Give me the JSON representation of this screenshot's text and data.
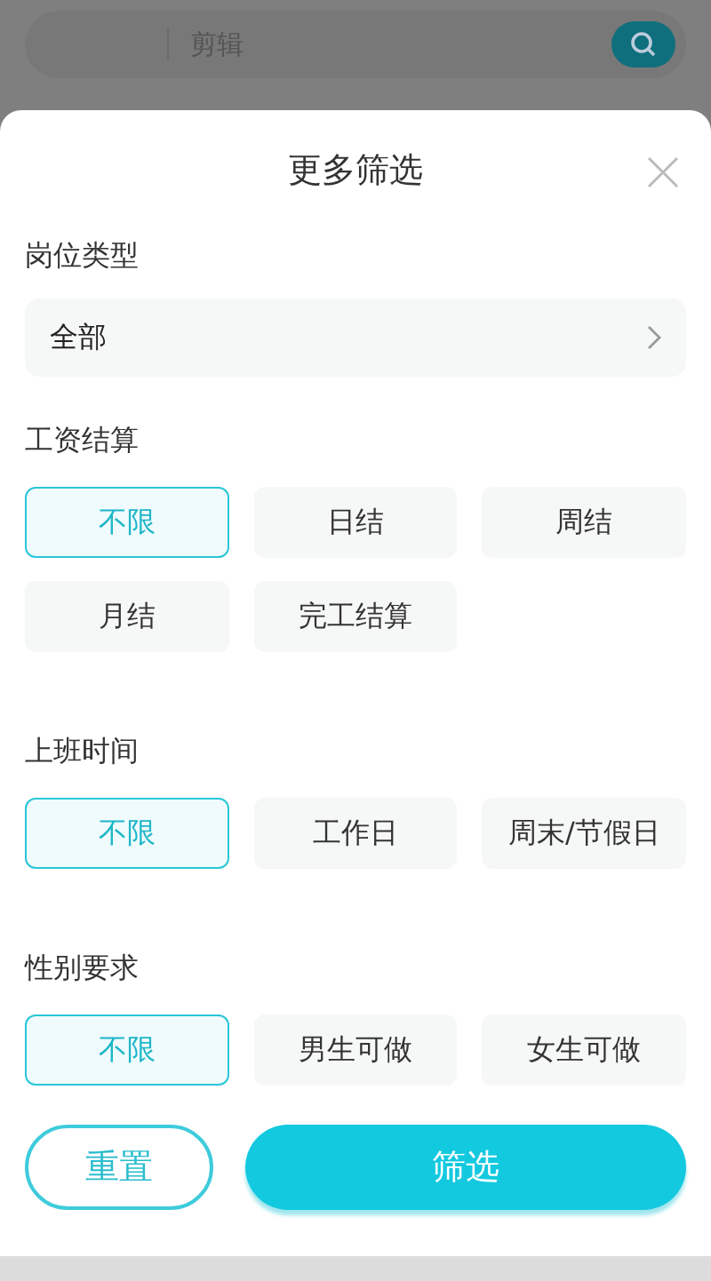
{
  "search": {
    "value": "剪辑"
  },
  "sheet": {
    "title": "更多筛选",
    "job_type": {
      "label": "岗位类型",
      "value": "全部"
    },
    "groups": [
      {
        "label": "工资结算",
        "options": [
          {
            "label": "不限",
            "selected": true
          },
          {
            "label": "日结",
            "selected": false
          },
          {
            "label": "周结",
            "selected": false
          },
          {
            "label": "月结",
            "selected": false
          },
          {
            "label": "完工结算",
            "selected": false
          }
        ]
      },
      {
        "label": "上班时间",
        "options": [
          {
            "label": "不限",
            "selected": true
          },
          {
            "label": "工作日",
            "selected": false
          },
          {
            "label": "周末/节假日",
            "selected": false
          }
        ]
      },
      {
        "label": "性别要求",
        "options": [
          {
            "label": "不限",
            "selected": true
          },
          {
            "label": "男生可做",
            "selected": false
          },
          {
            "label": "女生可做",
            "selected": false
          }
        ]
      }
    ],
    "buttons": {
      "reset": "重置",
      "apply": "筛选"
    }
  }
}
